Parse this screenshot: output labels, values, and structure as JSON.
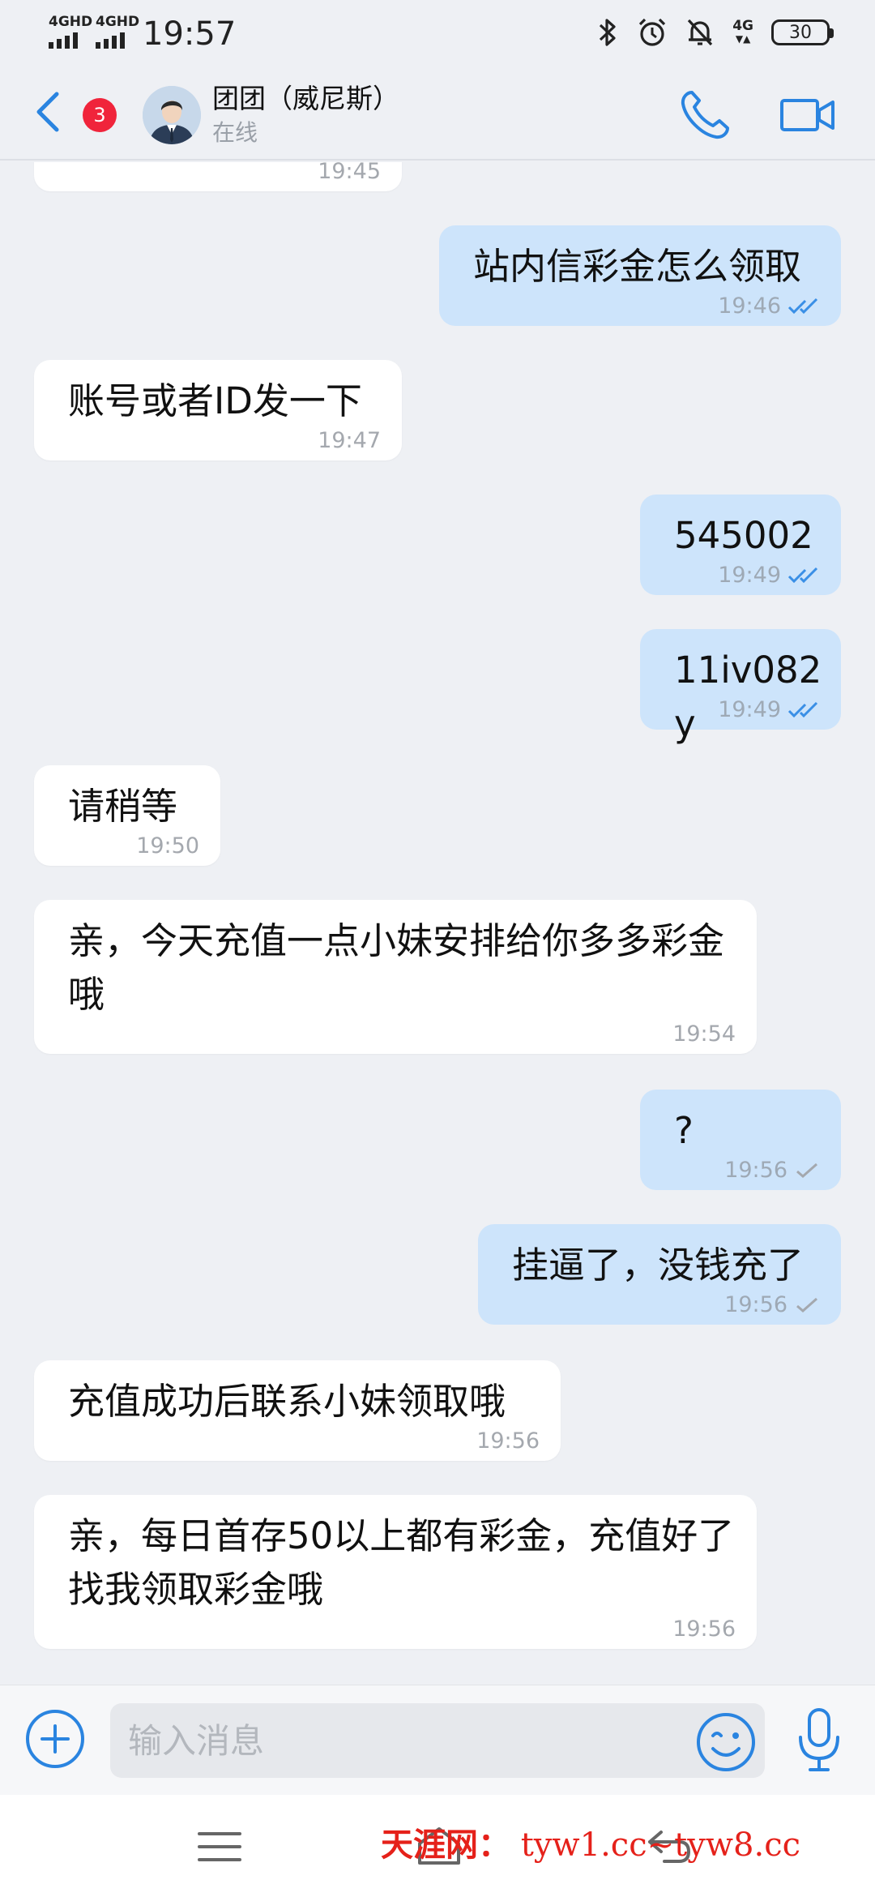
{
  "status_bar": {
    "network_1": "4GHD",
    "network_2": "4GHD",
    "time": "19:57",
    "network_3": "4G",
    "battery": "30"
  },
  "header": {
    "unread_count": "3",
    "contact_name": "团团（威尼斯）",
    "contact_status": "在线"
  },
  "messages": [
    {
      "direction": "in",
      "text": "",
      "time": "19:45",
      "ticks": ""
    },
    {
      "direction": "out",
      "text": "站内信彩金怎么领取",
      "time": "19:46",
      "ticks": "read"
    },
    {
      "direction": "in",
      "text": "账号或者ID发一下",
      "time": "19:47",
      "ticks": ""
    },
    {
      "direction": "out",
      "text": "545002",
      "time": "19:49",
      "ticks": "read"
    },
    {
      "direction": "out",
      "text": "11iv082y",
      "time": "19:49",
      "ticks": "read"
    },
    {
      "direction": "in",
      "text": "请稍等",
      "time": "19:50",
      "ticks": ""
    },
    {
      "direction": "in",
      "text": "亲，今天充值一点小妹安排给你多多彩金哦",
      "time": "19:54",
      "ticks": ""
    },
    {
      "direction": "out",
      "text": "?",
      "time": "19:56",
      "ticks": "sent"
    },
    {
      "direction": "out",
      "text": "挂逼了，没钱充了",
      "time": "19:56",
      "ticks": "sent"
    },
    {
      "direction": "in",
      "text": "充值成功后联系小妹领取哦",
      "time": "19:56",
      "ticks": ""
    },
    {
      "direction": "in",
      "text": "亲，每日首存50以上都有彩金，充值好了找我领取彩金哦",
      "time": "19:56",
      "ticks": ""
    }
  ],
  "input_bar": {
    "placeholder": "输入消息"
  },
  "watermark": {
    "name": "天涯网：",
    "url": "tyw1.cc~tyw8.cc"
  },
  "colors": {
    "accent": "#2a84e0",
    "badge": "#f0243b",
    "outgoing_bubble": "#cde4fb",
    "incoming_bubble": "#ffffff",
    "background": "#eef0f4",
    "watermark": "#e5211a"
  }
}
